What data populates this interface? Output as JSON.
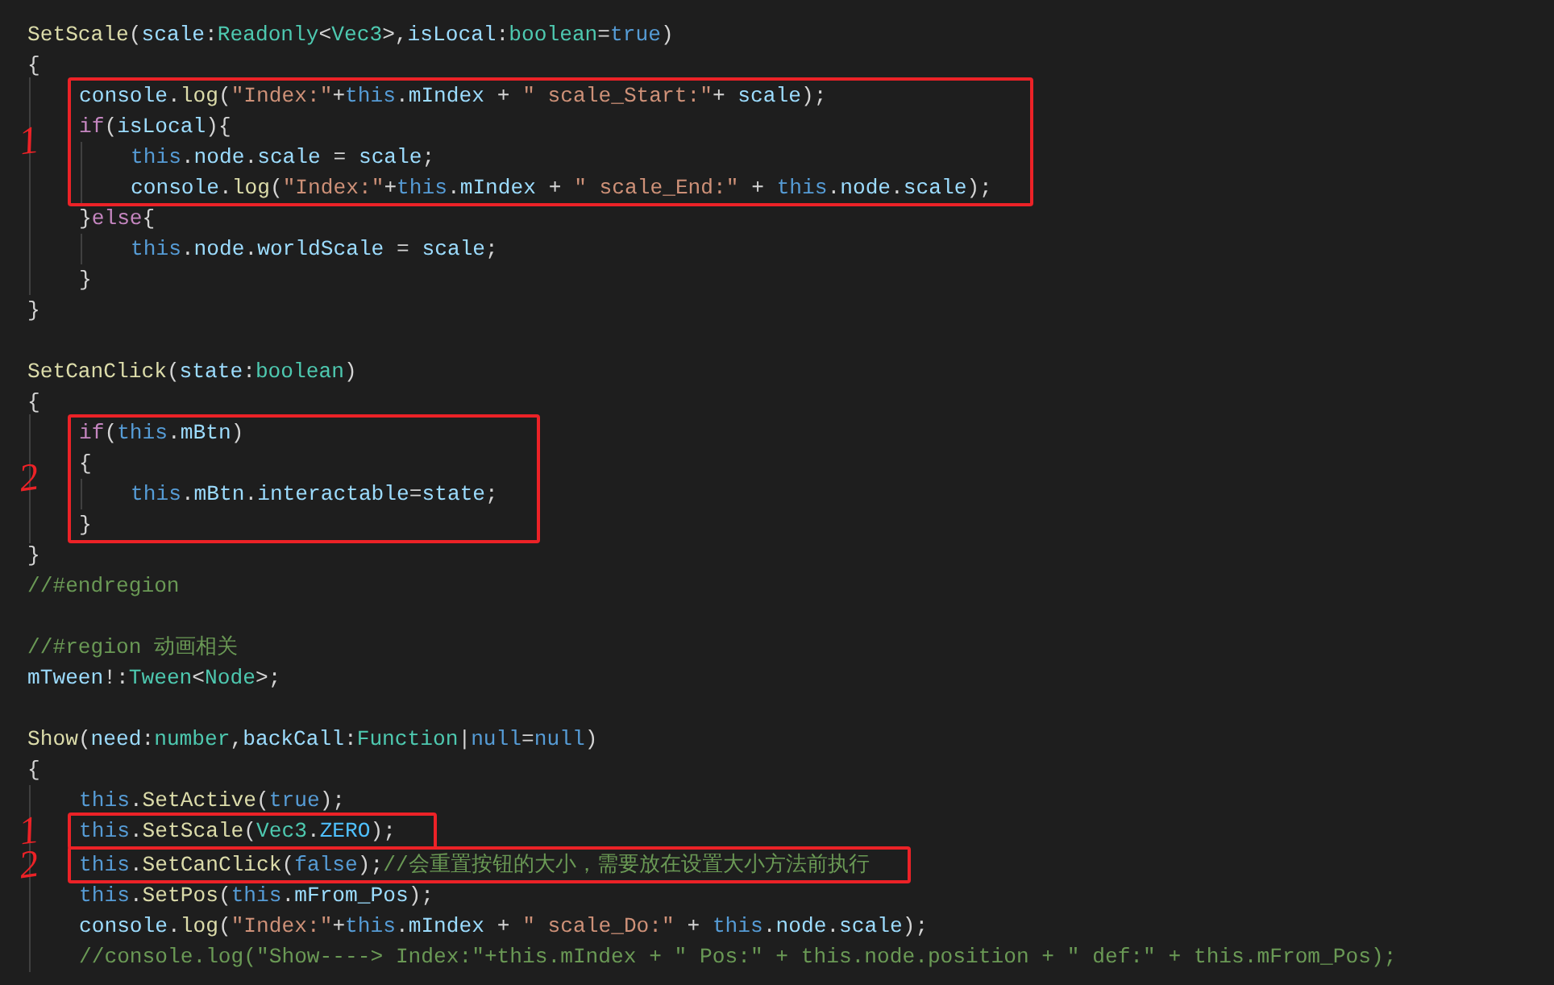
{
  "code": [
    {
      "kind": "line",
      "tokens": [
        {
          "text": "SetScale",
          "kind": "fn"
        },
        {
          "text": "(",
          "kind": "p"
        },
        {
          "text": "scale",
          "kind": "v"
        },
        {
          "text": ":",
          "kind": "p"
        },
        {
          "text": "Readonly",
          "kind": "t"
        },
        {
          "text": "<",
          "kind": "p"
        },
        {
          "text": "Vec3",
          "kind": "t"
        },
        {
          "text": ">,",
          "kind": "p"
        },
        {
          "text": "isLocal",
          "kind": "v"
        },
        {
          "text": ":",
          "kind": "p"
        },
        {
          "text": "boolean",
          "kind": "t"
        },
        {
          "text": "=",
          "kind": "p"
        },
        {
          "text": "true",
          "kind": "kw"
        },
        {
          "text": ")",
          "kind": "p"
        }
      ]
    },
    {
      "kind": "line",
      "tokens": [
        {
          "text": "{",
          "kind": "p"
        }
      ],
      "children": [
        {
          "kind": "box",
          "mark": "1",
          "lines": [
            {
              "kind": "line",
              "tokens": [
                {
                  "text": "console",
                  "kind": "v"
                },
                {
                  "text": ".",
                  "kind": "p"
                },
                {
                  "text": "log",
                  "kind": "fn"
                },
                {
                  "text": "(",
                  "kind": "p"
                },
                {
                  "text": "\"Index:\"",
                  "kind": "s"
                },
                {
                  "text": "+",
                  "kind": "p"
                },
                {
                  "text": "this",
                  "kind": "kw"
                },
                {
                  "text": ".",
                  "kind": "p"
                },
                {
                  "text": "mIndex",
                  "kind": "v"
                },
                {
                  "text": " + ",
                  "kind": "p"
                },
                {
                  "text": "\" scale_Start:\"",
                  "kind": "s"
                },
                {
                  "text": "+ ",
                  "kind": "p"
                },
                {
                  "text": "scale",
                  "kind": "v"
                },
                {
                  "text": ");",
                  "kind": "p"
                }
              ]
            },
            {
              "kind": "line",
              "tokens": [
                {
                  "text": "if",
                  "kind": "ctl"
                },
                {
                  "text": "(",
                  "kind": "p"
                },
                {
                  "text": "isLocal",
                  "kind": "v"
                },
                {
                  "text": "){",
                  "kind": "p"
                }
              ],
              "children": [
                {
                  "kind": "line",
                  "tokens": [
                    {
                      "text": "this",
                      "kind": "kw"
                    },
                    {
                      "text": ".",
                      "kind": "p"
                    },
                    {
                      "text": "node",
                      "kind": "v"
                    },
                    {
                      "text": ".",
                      "kind": "p"
                    },
                    {
                      "text": "scale",
                      "kind": "v"
                    },
                    {
                      "text": " = ",
                      "kind": "p"
                    },
                    {
                      "text": "scale",
                      "kind": "v"
                    },
                    {
                      "text": ";",
                      "kind": "p"
                    }
                  ]
                },
                {
                  "kind": "line",
                  "tokens": [
                    {
                      "text": "console",
                      "kind": "v"
                    },
                    {
                      "text": ".",
                      "kind": "p"
                    },
                    {
                      "text": "log",
                      "kind": "fn"
                    },
                    {
                      "text": "(",
                      "kind": "p"
                    },
                    {
                      "text": "\"Index:\"",
                      "kind": "s"
                    },
                    {
                      "text": "+",
                      "kind": "p"
                    },
                    {
                      "text": "this",
                      "kind": "kw"
                    },
                    {
                      "text": ".",
                      "kind": "p"
                    },
                    {
                      "text": "mIndex",
                      "kind": "v"
                    },
                    {
                      "text": " + ",
                      "kind": "p"
                    },
                    {
                      "text": "\" scale_End:\"",
                      "kind": "s"
                    },
                    {
                      "text": " + ",
                      "kind": "p"
                    },
                    {
                      "text": "this",
                      "kind": "kw"
                    },
                    {
                      "text": ".",
                      "kind": "p"
                    },
                    {
                      "text": "node",
                      "kind": "v"
                    },
                    {
                      "text": ".",
                      "kind": "p"
                    },
                    {
                      "text": "scale",
                      "kind": "v"
                    },
                    {
                      "text": ");",
                      "kind": "p"
                    }
                  ]
                }
              ]
            }
          ]
        },
        {
          "kind": "line",
          "tokens": [
            {
              "text": "}",
              "kind": "p"
            },
            {
              "text": "else",
              "kind": "ctl"
            },
            {
              "text": "{",
              "kind": "p"
            }
          ],
          "children": [
            {
              "kind": "line",
              "tokens": [
                {
                  "text": "this",
                  "kind": "kw"
                },
                {
                  "text": ".",
                  "kind": "p"
                },
                {
                  "text": "node",
                  "kind": "v"
                },
                {
                  "text": ".",
                  "kind": "p"
                },
                {
                  "text": "worldScale",
                  "kind": "v"
                },
                {
                  "text": " = ",
                  "kind": "p"
                },
                {
                  "text": "scale",
                  "kind": "v"
                },
                {
                  "text": ";",
                  "kind": "p"
                }
              ]
            }
          ]
        },
        {
          "kind": "line",
          "tokens": [
            {
              "text": "}",
              "kind": "p"
            }
          ]
        }
      ]
    },
    {
      "kind": "line",
      "tokens": [
        {
          "text": "}",
          "kind": "p"
        }
      ]
    },
    {
      "kind": "blank"
    },
    {
      "kind": "line",
      "tokens": [
        {
          "text": "SetCanClick",
          "kind": "fn"
        },
        {
          "text": "(",
          "kind": "p"
        },
        {
          "text": "state",
          "kind": "v"
        },
        {
          "text": ":",
          "kind": "p"
        },
        {
          "text": "boolean",
          "kind": "t"
        },
        {
          "text": ")",
          "kind": "p"
        }
      ]
    },
    {
      "kind": "line",
      "tokens": [
        {
          "text": "{",
          "kind": "p"
        }
      ],
      "children": [
        {
          "kind": "box",
          "mark": "2",
          "lines": [
            {
              "kind": "line",
              "tokens": [
                {
                  "text": "if",
                  "kind": "ctl"
                },
                {
                  "text": "(",
                  "kind": "p"
                },
                {
                  "text": "this",
                  "kind": "kw"
                },
                {
                  "text": ".",
                  "kind": "p"
                },
                {
                  "text": "mBtn",
                  "kind": "v"
                },
                {
                  "text": ")",
                  "kind": "p"
                }
              ]
            },
            {
              "kind": "line",
              "tokens": [
                {
                  "text": "{",
                  "kind": "p"
                }
              ],
              "children": [
                {
                  "kind": "line",
                  "tokens": [
                    {
                      "text": "this",
                      "kind": "kw"
                    },
                    {
                      "text": ".",
                      "kind": "p"
                    },
                    {
                      "text": "mBtn",
                      "kind": "v"
                    },
                    {
                      "text": ".",
                      "kind": "p"
                    },
                    {
                      "text": "interactable",
                      "kind": "v"
                    },
                    {
                      "text": "=",
                      "kind": "p"
                    },
                    {
                      "text": "state",
                      "kind": "v"
                    },
                    {
                      "text": ";",
                      "kind": "p"
                    }
                  ]
                }
              ]
            },
            {
              "kind": "line",
              "tokens": [
                {
                  "text": "}",
                  "kind": "p"
                }
              ]
            }
          ]
        }
      ]
    },
    {
      "kind": "line",
      "tokens": [
        {
          "text": "}",
          "kind": "p"
        }
      ]
    },
    {
      "kind": "line",
      "tokens": [
        {
          "text": "//#endregion",
          "kind": "cmt"
        }
      ]
    },
    {
      "kind": "blank"
    },
    {
      "kind": "line",
      "tokens": [
        {
          "text": "//#region 动画相关",
          "kind": "cmt"
        }
      ]
    },
    {
      "kind": "line",
      "tokens": [
        {
          "text": "mTween",
          "kind": "v"
        },
        {
          "text": "!:",
          "kind": "p"
        },
        {
          "text": "Tween",
          "kind": "t"
        },
        {
          "text": "<",
          "kind": "p"
        },
        {
          "text": "Node",
          "kind": "t"
        },
        {
          "text": ">;",
          "kind": "p"
        }
      ]
    },
    {
      "kind": "blank"
    },
    {
      "kind": "line",
      "tokens": [
        {
          "text": "Show",
          "kind": "fn"
        },
        {
          "text": "(",
          "kind": "p"
        },
        {
          "text": "need",
          "kind": "v"
        },
        {
          "text": ":",
          "kind": "p"
        },
        {
          "text": "number",
          "kind": "t"
        },
        {
          "text": ",",
          "kind": "p"
        },
        {
          "text": "backCall",
          "kind": "v"
        },
        {
          "text": ":",
          "kind": "p"
        },
        {
          "text": "Function",
          "kind": "t"
        },
        {
          "text": "|",
          "kind": "p"
        },
        {
          "text": "null",
          "kind": "kw"
        },
        {
          "text": "=",
          "kind": "p"
        },
        {
          "text": "null",
          "kind": "kw"
        },
        {
          "text": ")",
          "kind": "p"
        }
      ]
    },
    {
      "kind": "line",
      "tokens": [
        {
          "text": "{",
          "kind": "p"
        }
      ],
      "children": [
        {
          "kind": "line",
          "tokens": [
            {
              "text": "this",
              "kind": "kw"
            },
            {
              "text": ".",
              "kind": "p"
            },
            {
              "text": "SetActive",
              "kind": "fn"
            },
            {
              "text": "(",
              "kind": "p"
            },
            {
              "text": "true",
              "kind": "kw"
            },
            {
              "text": ");",
              "kind": "p"
            }
          ]
        },
        {
          "kind": "box",
          "mark": "1",
          "lines": [
            {
              "kind": "line",
              "tokens": [
                {
                  "text": "this",
                  "kind": "kw"
                },
                {
                  "text": ".",
                  "kind": "p"
                },
                {
                  "text": "SetScale",
                  "kind": "fn"
                },
                {
                  "text": "(",
                  "kind": "p"
                },
                {
                  "text": "Vec3",
                  "kind": "t"
                },
                {
                  "text": ".",
                  "kind": "p"
                },
                {
                  "text": "ZERO",
                  "kind": "c"
                },
                {
                  "text": ");",
                  "kind": "p"
                }
              ]
            }
          ]
        },
        {
          "kind": "box",
          "mark": "2",
          "lines": [
            {
              "kind": "line",
              "tokens": [
                {
                  "text": "this",
                  "kind": "kw"
                },
                {
                  "text": ".",
                  "kind": "p"
                },
                {
                  "text": "SetCanClick",
                  "kind": "fn"
                },
                {
                  "text": "(",
                  "kind": "p"
                },
                {
                  "text": "false",
                  "kind": "kw"
                },
                {
                  "text": ");",
                  "kind": "p"
                },
                {
                  "text": "//会重置按钮的大小，需要放在设置大小方法前执行",
                  "kind": "cmt"
                }
              ]
            }
          ]
        },
        {
          "kind": "line",
          "tokens": [
            {
              "text": "this",
              "kind": "kw"
            },
            {
              "text": ".",
              "kind": "p"
            },
            {
              "text": "SetPos",
              "kind": "fn"
            },
            {
              "text": "(",
              "kind": "p"
            },
            {
              "text": "this",
              "kind": "kw"
            },
            {
              "text": ".",
              "kind": "p"
            },
            {
              "text": "mFrom_Pos",
              "kind": "v"
            },
            {
              "text": ");",
              "kind": "p"
            }
          ]
        },
        {
          "kind": "line",
          "tokens": [
            {
              "text": "console",
              "kind": "v"
            },
            {
              "text": ".",
              "kind": "p"
            },
            {
              "text": "log",
              "kind": "fn"
            },
            {
              "text": "(",
              "kind": "p"
            },
            {
              "text": "\"Index:\"",
              "kind": "s"
            },
            {
              "text": "+",
              "kind": "p"
            },
            {
              "text": "this",
              "kind": "kw"
            },
            {
              "text": ".",
              "kind": "p"
            },
            {
              "text": "mIndex",
              "kind": "v"
            },
            {
              "text": " + ",
              "kind": "p"
            },
            {
              "text": "\" scale_Do:\"",
              "kind": "s"
            },
            {
              "text": " + ",
              "kind": "p"
            },
            {
              "text": "this",
              "kind": "kw"
            },
            {
              "text": ".",
              "kind": "p"
            },
            {
              "text": "node",
              "kind": "v"
            },
            {
              "text": ".",
              "kind": "p"
            },
            {
              "text": "scale",
              "kind": "v"
            },
            {
              "text": ");",
              "kind": "p"
            }
          ]
        },
        {
          "kind": "line",
          "tokens": [
            {
              "text": "//console.log(\"Show----> Index:\"+this.mIndex + \" Pos:\" + this.node.position + \" def:\" + this.mFrom_Pos);",
              "kind": "cmt"
            }
          ]
        }
      ]
    }
  ]
}
